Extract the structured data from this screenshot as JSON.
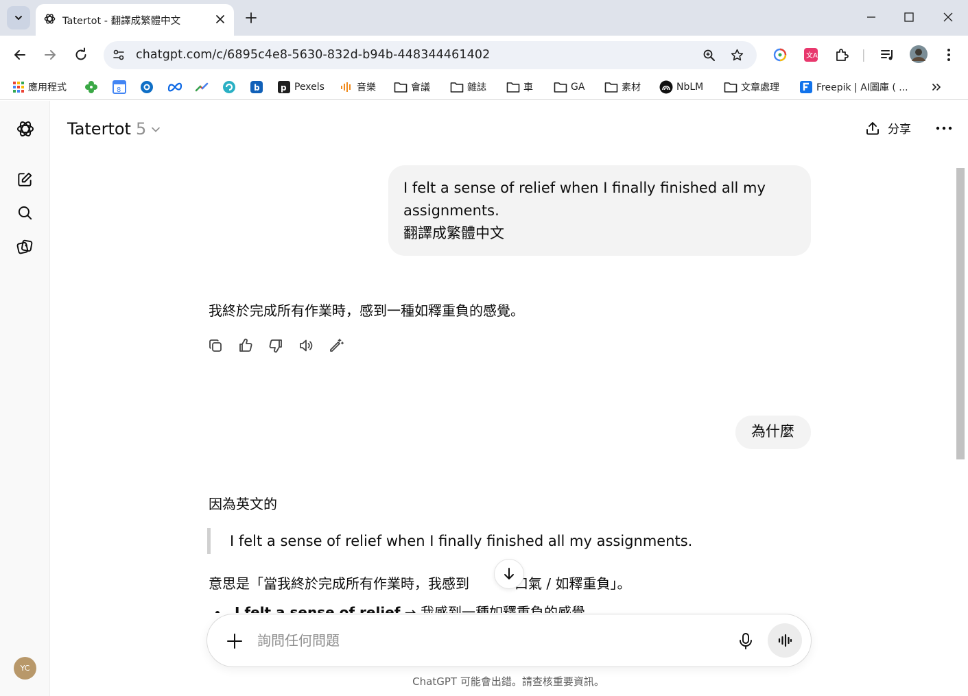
{
  "browser": {
    "tab": {
      "title": "Tatertot - 翻譯成繁體中文"
    },
    "address_bar": {
      "url": "chatgpt.com/c/6895c4e8-5630-832d-b94b-448344461402"
    },
    "bookmarks": [
      {
        "label": "應用程式",
        "icon": "apps-grid-icon"
      },
      {
        "label": "",
        "icon": "clover-icon"
      },
      {
        "label": "",
        "icon": "calendar-icon"
      },
      {
        "label": "",
        "icon": "ring-icon"
      },
      {
        "label": "",
        "icon": "meta-icon"
      },
      {
        "label": "",
        "icon": "trend-icon"
      },
      {
        "label": "",
        "icon": "swirl-icon"
      },
      {
        "label": "",
        "icon": "b-app-icon"
      },
      {
        "label": "Pexels",
        "icon": "pexels-icon"
      },
      {
        "label": "音樂",
        "icon": "music-icon"
      },
      {
        "label": "會議",
        "icon": "folder-icon"
      },
      {
        "label": "雜誌",
        "icon": "folder-icon"
      },
      {
        "label": "車",
        "icon": "folder-icon"
      },
      {
        "label": "GA",
        "icon": "folder-icon"
      },
      {
        "label": "素材",
        "icon": "folder-icon"
      },
      {
        "label": "NbLM",
        "icon": "notebooklm-icon"
      },
      {
        "label": "文章處理",
        "icon": "folder-icon"
      },
      {
        "label": "Freepik | AI圖庫 ( ...",
        "icon": "freepik-icon"
      }
    ],
    "colors": {
      "tab_strip": "#dfe3eb",
      "omnibox": "#eef1f7"
    }
  },
  "app": {
    "model": {
      "name": "Tatertot",
      "version": "5"
    },
    "header": {
      "share_label": "分享"
    },
    "sidebar": {
      "avatar_initials": "YC"
    },
    "messages": {
      "user_1_line_1": "I felt a sense of relief when I finally finished all my assignments.",
      "user_1_line_2": "翻譯成繁體中文",
      "assistant_1": "我終於完成所有作業時，感到一種如釋重負的感覺。",
      "user_2": "為什麼",
      "assistant_2_intro": "因為英文的",
      "assistant_2_quote": "I felt a sense of relief when I finally finished all my assignments.",
      "assistant_2_meaning_before": "意思是「當我終於完成所有作業時，我感到",
      "assistant_2_meaning_after": "一口氣 / 如釋重負」。",
      "assistant_2_bullet_bold": "I felt a sense of relief",
      "assistant_2_bullet_rest": " → 我感到一種如釋重負的感覺"
    },
    "composer": {
      "placeholder": "詢問任何問題"
    },
    "disclaimer": "ChatGPT 可能會出錯。請查核重要資訊。",
    "colors": {
      "user_bubble": "#f3f3f3",
      "avatar": "#b8986a",
      "sidebar": "#f9f9f9"
    }
  }
}
